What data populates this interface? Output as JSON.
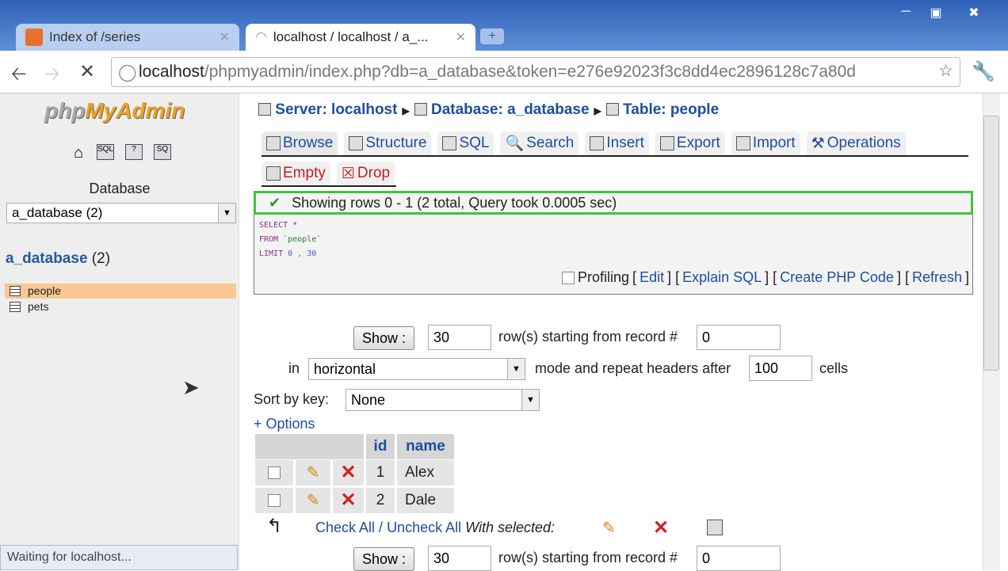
{
  "browser": {
    "tabs": [
      {
        "title": "Index of /series"
      },
      {
        "title": "localhost / localhost / a_..."
      }
    ],
    "url_host": "localhost",
    "url_path": "/phpmyadmin/index.php?db=a_database&token=e276e92023f3c8dd4ec2896128c7a80d",
    "status": "Waiting for localhost..."
  },
  "sidebar": {
    "logo": "phpMyAdmin",
    "db_label": "Database",
    "db_select": "a_database (2)",
    "db_name": "a_database",
    "db_count": "(2)",
    "tables": [
      "people",
      "pets"
    ]
  },
  "crumb": {
    "server": "Server: localhost",
    "database": "Database: a_database",
    "table": "Table: people"
  },
  "tabs": [
    "Browse",
    "Structure",
    "SQL",
    "Search",
    "Insert",
    "Export",
    "Import",
    "Operations"
  ],
  "tabs2": [
    "Empty",
    "Drop"
  ],
  "message": "Showing rows 0 - 1 (2 total, Query took 0.0005 sec)",
  "sql": {
    "l1": "SELECT *",
    "l2a": "FROM ",
    "l2b": "`people`",
    "l3a": "LIMIT ",
    "l3b": "0 , 30"
  },
  "sql_actions": {
    "profiling": "Profiling",
    "edit": "Edit",
    "explain": "Explain SQL",
    "php": "Create PHP Code",
    "refresh": "Refresh"
  },
  "nav": {
    "show": "Show :",
    "rows": "30",
    "starting": "row(s) starting from record #",
    "start": "0",
    "in": "in",
    "mode": "horizontal",
    "mode_after": "mode and repeat headers after",
    "repeat": "100",
    "cells": "cells",
    "sort_label": "Sort by key:",
    "sort": "None",
    "options": "+ Options"
  },
  "table": {
    "headers": [
      "id",
      "name"
    ],
    "rows": [
      [
        "1",
        "Alex"
      ],
      [
        "2",
        "Dale"
      ]
    ]
  },
  "bulk": {
    "check_all": "Check All",
    "sep": " / ",
    "uncheck_all": "Uncheck All",
    "with_selected": "With selected:"
  }
}
